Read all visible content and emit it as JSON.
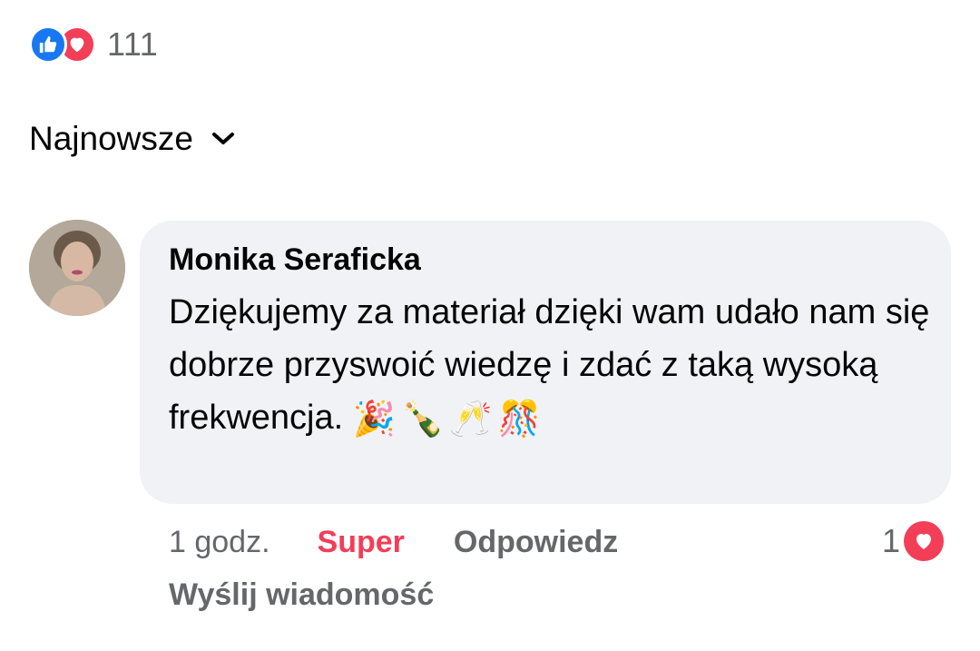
{
  "post_reactions": {
    "icons": [
      "like-icon",
      "love-icon"
    ],
    "count": "111",
    "colors": {
      "like": "#1877f2",
      "love": "#f33e58"
    }
  },
  "sort": {
    "label": "Najnowsze",
    "icon": "chevron-down-icon"
  },
  "comment": {
    "author": "Monika Seraficka",
    "text": "Dziękujemy za materiał dzięki wam udało nam się dobrze przyswoić wiedzę i zdać z taką wysoką frekwencja.",
    "emojis": [
      "🎉",
      "🍾",
      "🥂",
      "🎊"
    ],
    "time": "1 godz.",
    "reaction_action": "Super",
    "reply_action": "Odpowiedz",
    "send_message_action": "Wyślij wiadomość",
    "reaction_count": "1",
    "reaction_icon": "love-icon",
    "bubble_color": "#f0f2f5"
  }
}
